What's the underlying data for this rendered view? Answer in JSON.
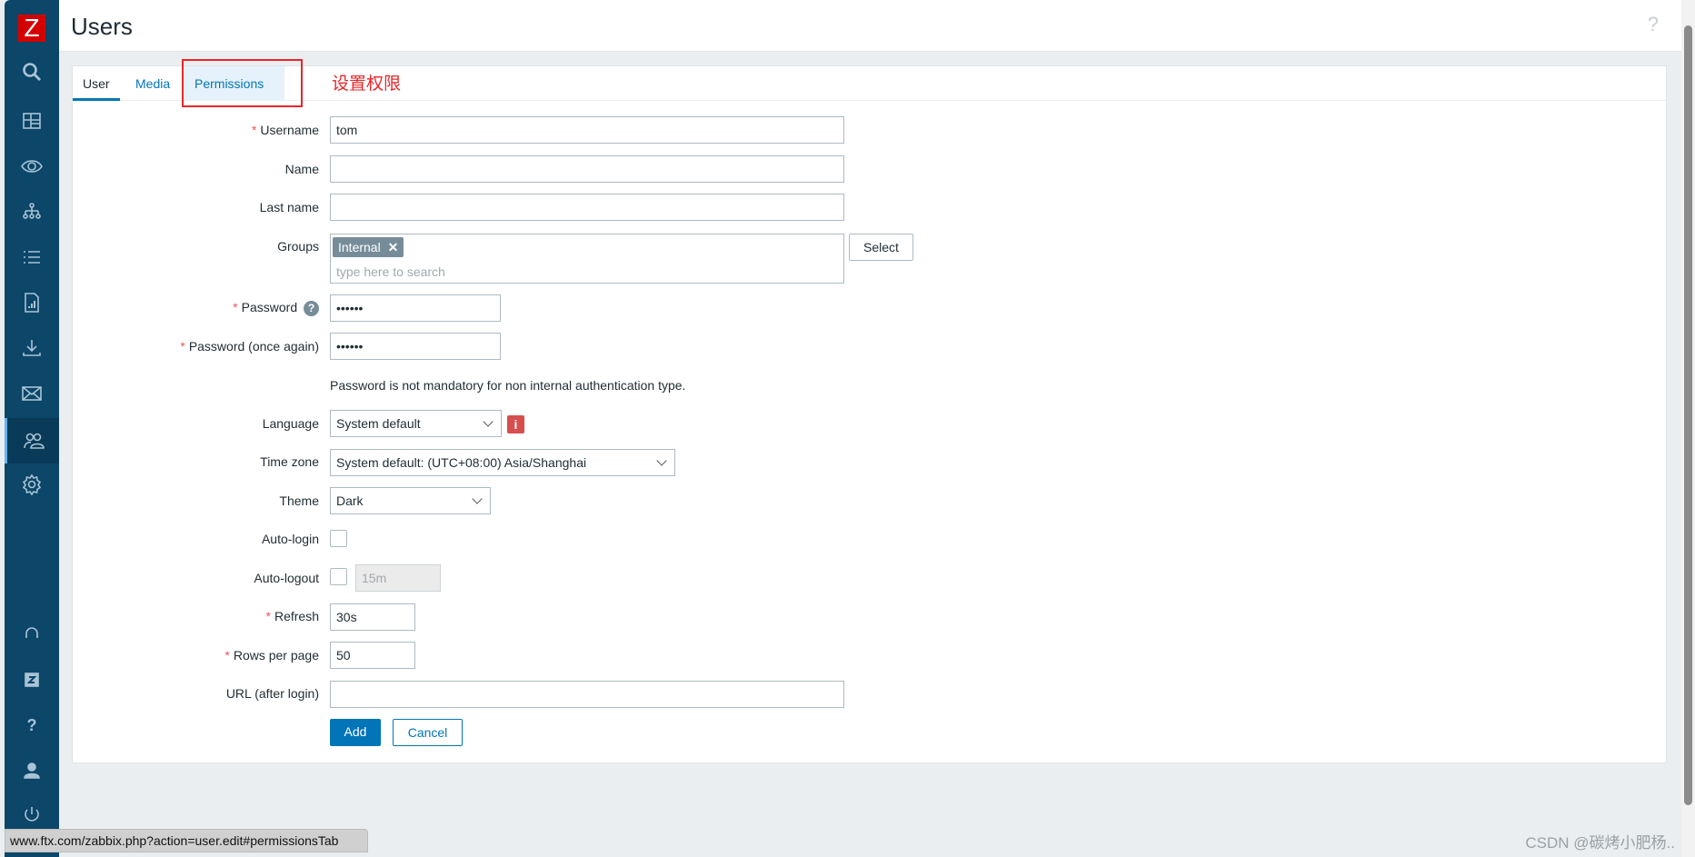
{
  "header": {
    "title": "Users",
    "help": "?"
  },
  "sidebar": {
    "logo": "Z",
    "items": [
      "search-icon",
      "dashboard-icon",
      "monitoring-eye-icon",
      "inventory-hierarchy-icon",
      "reports-list-icon",
      "report-chart-icon",
      "data-collection-download-icon",
      "alerts-mail-icon",
      "users-icon",
      "administration-gear-icon"
    ],
    "active": "users-icon",
    "bottom": [
      "support-headset-icon",
      "zabbix-share-icon",
      "help-icon",
      "user-settings-icon",
      "sign-out-icon"
    ]
  },
  "tabs": [
    {
      "label": "User",
      "active": true
    },
    {
      "label": "Media"
    },
    {
      "label": "Permissions"
    }
  ],
  "annotation": "设置权限",
  "form": {
    "username": {
      "label": "Username",
      "value": "tom"
    },
    "name": {
      "label": "Name",
      "value": ""
    },
    "last_name": {
      "label": "Last name",
      "value": ""
    },
    "groups": {
      "label": "Groups",
      "tag": "Internal",
      "placeholder": "type here to search",
      "select": "Select"
    },
    "password": {
      "label": "Password",
      "value": "••••••"
    },
    "password2": {
      "label": "Password (once again)",
      "value": "••••••"
    },
    "password_note": "Password is not mandatory for non internal authentication type.",
    "language": {
      "label": "Language",
      "value": "System default"
    },
    "timezone": {
      "label": "Time zone",
      "value": "System default: (UTC+08:00) Asia/Shanghai"
    },
    "theme": {
      "label": "Theme",
      "value": "Dark"
    },
    "autologin": {
      "label": "Auto-login",
      "checked": false
    },
    "autologout": {
      "label": "Auto-logout",
      "checked": false,
      "value": "15m"
    },
    "refresh": {
      "label": "Refresh",
      "value": "30s"
    },
    "rows": {
      "label": "Rows per page",
      "value": "50"
    },
    "url": {
      "label": "URL (after login)",
      "value": ""
    },
    "add": "Add",
    "cancel": "Cancel"
  },
  "statusbar": "www.ftx.com/zabbix.php?action=user.edit#permissionsTab",
  "watermark": "CSDN @碳烤小肥杨..",
  "colors": {
    "sidebar": "#0c4668",
    "accent": "#0275b8",
    "required": "#e45959",
    "annotation": "#e8262b"
  }
}
